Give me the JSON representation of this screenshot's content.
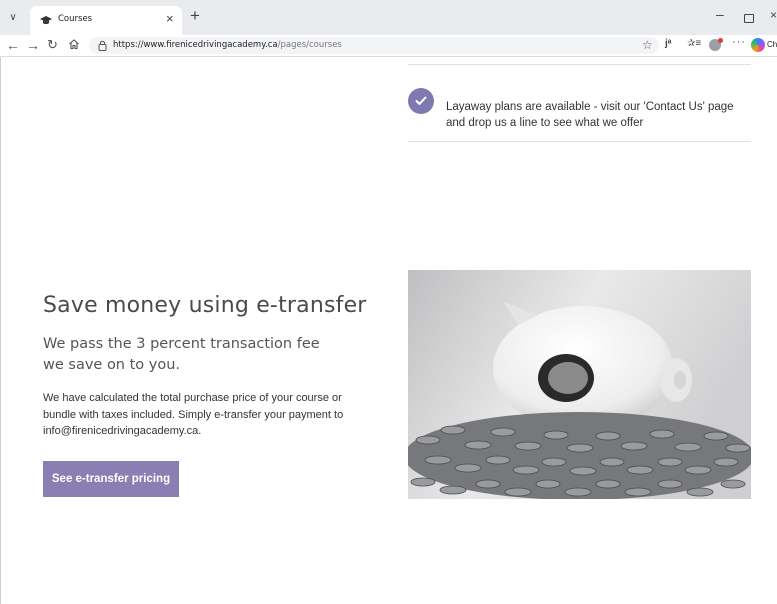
{
  "browser": {
    "tab_title": "Courses",
    "url_host": "https://www.firenicedrivingacademy.ca",
    "url_path": "/pages/courses",
    "copilot_label": "Ch"
  },
  "icons": {
    "tab_menu": "chevron-down-icon",
    "favicon": "graduation-cap-icon",
    "close": "close-icon",
    "new_tab": "plus-icon",
    "back": "arrow-left-icon",
    "forward": "arrow-right-icon",
    "reload": "reload-icon",
    "home": "home-icon",
    "lock": "lock-icon",
    "favorite": "star-icon",
    "check": "check-icon"
  },
  "layaway": {
    "text": "Layaway plans are available - visit our 'Contact Us' page and drop us a line to see what we offer"
  },
  "etransfer": {
    "title": "Save money using e-transfer",
    "subtitle": "We pass the 3 percent transaction fee we save on to you.",
    "body": "We have calculated the total purchase price of your course or bundle with taxes included. Simply e-transfer your payment to info@firenicedrivingacademy.ca.",
    "button_label": "See e-transfer pricing"
  },
  "colors": {
    "accent": "#8a7eb3",
    "check_badge": "#8079b0",
    "tabstrip": "#e9ebef"
  }
}
